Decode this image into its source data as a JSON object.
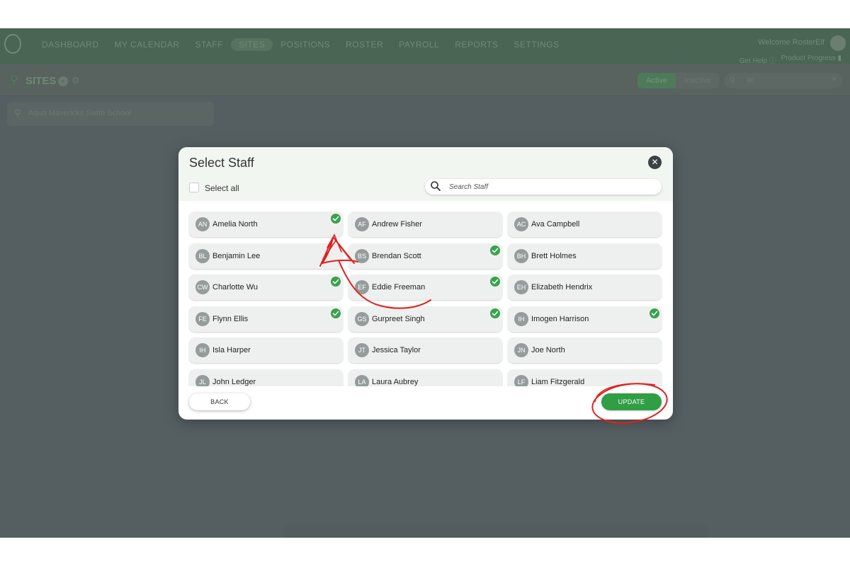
{
  "app": {
    "nav": [
      "DASHBOARD",
      "MY CALENDAR",
      "STAFF",
      "SITES",
      "POSITIONS",
      "ROSTER",
      "PAYROLL",
      "REPORTS",
      "SETTINGS"
    ],
    "active_nav": "SITES",
    "welcome": "Welcome RosterElf",
    "help": "Get Help",
    "product_progress": "Product Progress",
    "page_title": "SITES",
    "toggle_active": "Active",
    "toggle_inactive": "Inactive",
    "search_value": "aq",
    "site_name": "Aqua Mavericks Swim School"
  },
  "modal": {
    "title": "Select Staff",
    "select_all": "Select all",
    "search_placeholder": "Search Staff",
    "back_label": "BACK",
    "update_label": "UPDATE",
    "staff": [
      {
        "initials": "AN",
        "name": "Amelia North",
        "selected": true
      },
      {
        "initials": "AF",
        "name": "Andrew Fisher",
        "selected": false
      },
      {
        "initials": "AC",
        "name": "Ava Campbell",
        "selected": false
      },
      {
        "initials": "BL",
        "name": "Benjamin Lee",
        "selected": false
      },
      {
        "initials": "BS",
        "name": "Brendan Scott",
        "selected": true
      },
      {
        "initials": "BH",
        "name": "Brett Holmes",
        "selected": false
      },
      {
        "initials": "CW",
        "name": "Charlotte Wu",
        "selected": true
      },
      {
        "initials": "EF",
        "name": "Eddie Freeman",
        "selected": true
      },
      {
        "initials": "EH",
        "name": "Elizabeth Hendrix",
        "selected": false
      },
      {
        "initials": "FE",
        "name": "Flynn Ellis",
        "selected": true
      },
      {
        "initials": "GS",
        "name": "Gurpreet Singh",
        "selected": true
      },
      {
        "initials": "IH",
        "name": "Imogen Harrison",
        "selected": true
      },
      {
        "initials": "IH",
        "name": "Isla Harper",
        "selected": false
      },
      {
        "initials": "JT",
        "name": "Jessica Taylor",
        "selected": false
      },
      {
        "initials": "JN",
        "name": "Joe North",
        "selected": false
      },
      {
        "initials": "JL",
        "name": "John Ledger",
        "selected": false
      },
      {
        "initials": "LA",
        "name": "Laura Aubrey",
        "selected": false
      },
      {
        "initials": "LF",
        "name": "Liam Fitzgerald",
        "selected": false
      }
    ]
  },
  "colors": {
    "accent_green": "#2f9e44",
    "check_green": "#3aa14d",
    "annotation_red": "#e02020",
    "overlay": "#555f62"
  }
}
